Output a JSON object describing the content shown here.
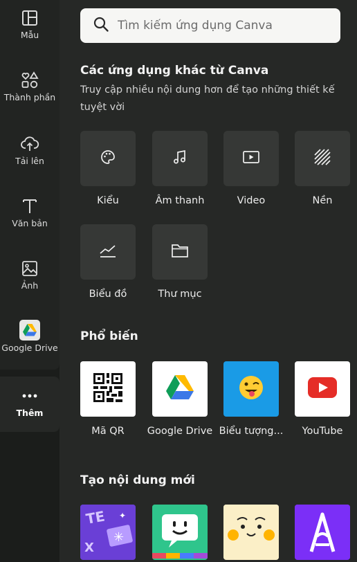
{
  "sidebar": {
    "items": [
      {
        "label": "Mẫu",
        "icon": "template-icon"
      },
      {
        "label": "Thành phần",
        "icon": "elements-icon"
      },
      {
        "label": "Tải lên",
        "icon": "upload-cloud-icon"
      },
      {
        "label": "Văn bản",
        "icon": "text-icon"
      },
      {
        "label": "Ảnh",
        "icon": "photo-icon"
      },
      {
        "label": "Google Drive",
        "icon": "google-drive-icon"
      },
      {
        "label": "Thêm",
        "icon": "more-dots-icon"
      }
    ]
  },
  "search": {
    "placeholder": "Tìm kiếm ứng dụng Canva"
  },
  "other_apps": {
    "title": "Các ứng dụng khác từ Canva",
    "subtitle": "Truy cập nhiều nội dung hơn để tạo những thiết kế tuyệt vời",
    "tiles": [
      {
        "label": "Kiểu",
        "icon": "palette-icon"
      },
      {
        "label": "Âm thanh",
        "icon": "music-note-icon"
      },
      {
        "label": "Video",
        "icon": "video-play-icon"
      },
      {
        "label": "Nền",
        "icon": "background-pattern-icon"
      },
      {
        "label": "Biểu đồ",
        "icon": "chart-line-icon"
      },
      {
        "label": "Thư mục",
        "icon": "folder-icon"
      }
    ]
  },
  "popular": {
    "title": "Phổ biến",
    "apps": [
      {
        "label": "Mã QR",
        "icon": "qr-code-icon"
      },
      {
        "label": "Google Drive",
        "icon": "google-drive-icon"
      },
      {
        "label": "Biểu tượng...",
        "icon": "emoji-wink-icon"
      },
      {
        "label": "YouTube",
        "icon": "youtube-icon"
      }
    ]
  },
  "create_new": {
    "title": "Tạo nội dung mới",
    "apps": [
      {
        "icon": "text-effects-icon"
      },
      {
        "icon": "chat-face-icon"
      },
      {
        "icon": "cute-face-icon"
      },
      {
        "icon": "letter-a-icon"
      }
    ]
  },
  "colors": {
    "background": "#262826",
    "sidebar": "#222422",
    "tile": "#363836",
    "youtube_red": "#e52d27",
    "emoji_blue": "#1a9be6"
  }
}
